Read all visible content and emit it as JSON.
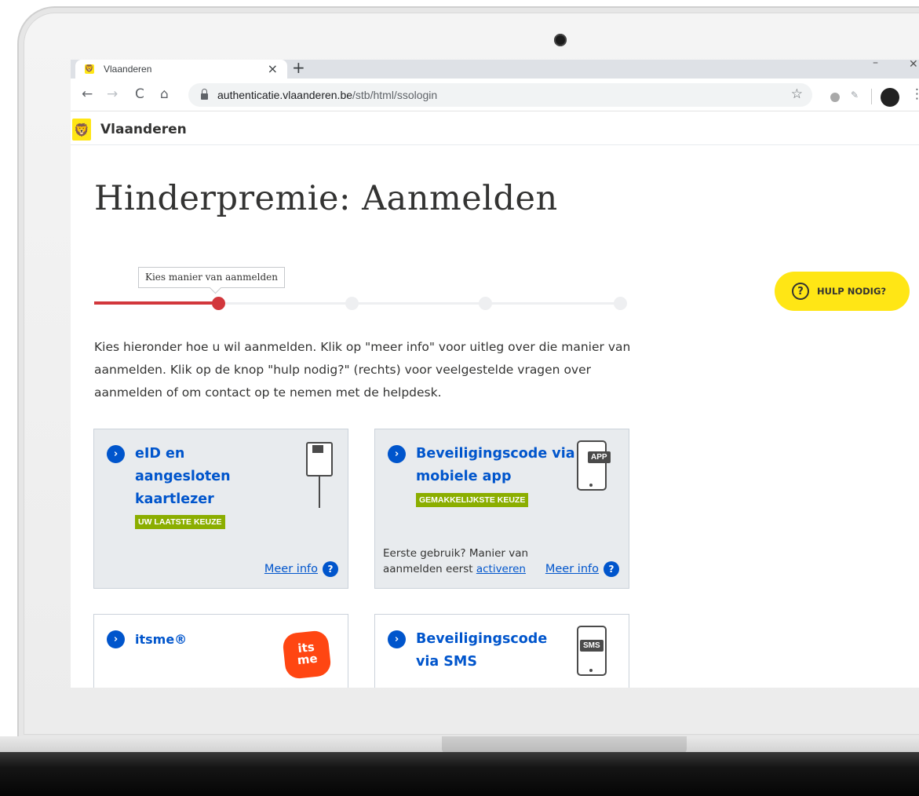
{
  "browser": {
    "tab_title": "Vlaanderen",
    "tab_close": "×",
    "new_tab": "+",
    "url_host": "authenticatie.vlaanderen.be",
    "url_path": "/stb/html/ssologin",
    "nav": {
      "back": "←",
      "forward": "→",
      "reload": "C",
      "home": "⌂"
    },
    "star": "☆",
    "menu": "⋮",
    "window_min": "–",
    "window_close": "✕"
  },
  "site": {
    "name": "Vlaanderen"
  },
  "page": {
    "title": "Hinderpremie: Aanmelden",
    "step_tooltip": "Kies manier van aanmelden",
    "progress": {
      "current_step": 1,
      "total_steps": 4
    },
    "intro": "Kies hieronder hoe u wil aanmelden. Klik op \"meer info\" voor uitleg over die manier van aanmelden. Klik op de knop \"hulp nodig?\" (rechts) voor veelgestelde vragen over aanmelden of om contact op te nemen met de helpdesk."
  },
  "help": {
    "icon": "?",
    "label": "HULP NODIG?"
  },
  "cards": [
    {
      "title": "eID en aangesloten kaartlezer",
      "badge": "UW LAATSTE KEUZE",
      "meer_info": "Meer info",
      "icon": "card-reader-icon"
    },
    {
      "title": "Beveiligingscode via mobiele app",
      "badge": "GEMAKKELIJKSTE KEUZE",
      "note": "Eerste gebruik? Manier van aanmelden eerst",
      "note_link": "activeren",
      "meer_info": "Meer info",
      "icon_tag": "APP",
      "icon": "phone-app-icon"
    },
    {
      "title": "itsme®",
      "logo_top": "its",
      "logo_bottom": "me",
      "icon": "itsme-logo"
    },
    {
      "title": "Beveiligingscode via SMS",
      "icon_tag": "SMS",
      "icon": "phone-sms-icon"
    }
  ],
  "icons": {
    "chevron": "›",
    "question": "?"
  },
  "colors": {
    "brand_yellow": "#ffe615",
    "link_blue": "#0055cc",
    "progress_red": "#d2373c",
    "badge_green": "#8bae00"
  }
}
